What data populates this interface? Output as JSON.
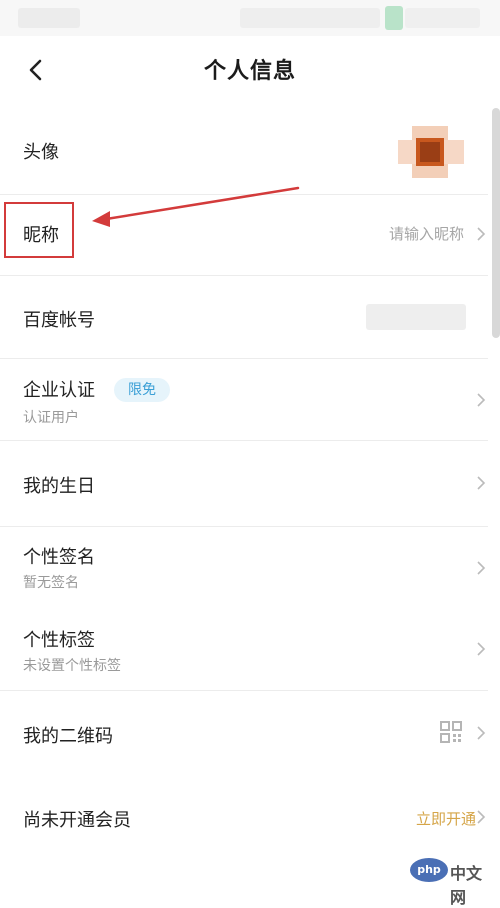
{
  "header": {
    "title": "个人信息"
  },
  "rows": {
    "avatar": {
      "label": "头像"
    },
    "nickname": {
      "label": "昵称",
      "placeholder": "请输入昵称"
    },
    "baidu_account": {
      "label": "百度帐号"
    },
    "enterprise": {
      "label": "企业认证",
      "badge": "限免",
      "sub": "认证用户"
    },
    "birthday": {
      "label": "我的生日"
    },
    "signature": {
      "label": "个性签名",
      "sub": "暂无签名"
    },
    "tags": {
      "label": "个性标签",
      "sub": "未设置个性标签"
    },
    "qrcode": {
      "label": "我的二维码"
    },
    "vip": {
      "label": "尚未开通会员",
      "action": "立即开通"
    }
  },
  "watermark": {
    "logo": "php",
    "text": "中文网"
  },
  "colors": {
    "accent_red": "#d33b3b",
    "badge_blue": "#3a9fd6",
    "vip_gold": "#d5a548"
  },
  "icons": {
    "back": "chevron-left-icon",
    "row": "chevron-right-icon",
    "qrcode": "qrcode-icon"
  }
}
